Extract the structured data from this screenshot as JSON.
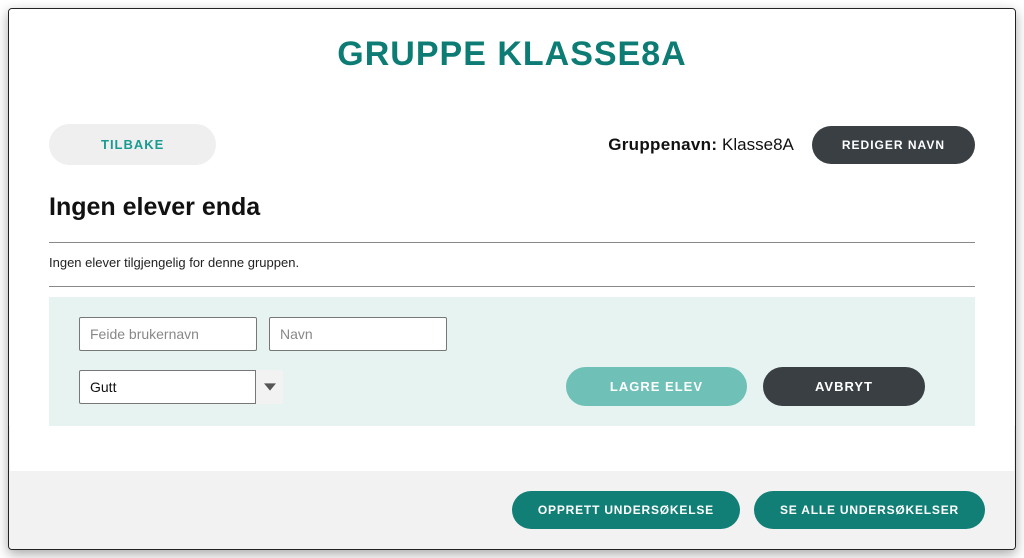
{
  "title": "GRUPPE KLASSE8A",
  "buttons": {
    "back": "TILBAKE",
    "editName": "REDIGER NAVN",
    "saveStudent": "LAGRE ELEV",
    "cancel": "AVBRYT",
    "createSurvey": "OPPRETT UNDERSØKELSE",
    "viewAllSurveys": "SE ALLE UNDERSØKELSER"
  },
  "groupName": {
    "label": "Gruppenavn:",
    "value": "Klasse8A"
  },
  "sectionHeading": "Ingen elever enda",
  "emptyMessage": "Ingen elever tilgjengelig for denne gruppen.",
  "form": {
    "usernamePlaceholder": "Feide brukernavn",
    "namePlaceholder": "Navn",
    "genderSelected": "Gutt"
  }
}
